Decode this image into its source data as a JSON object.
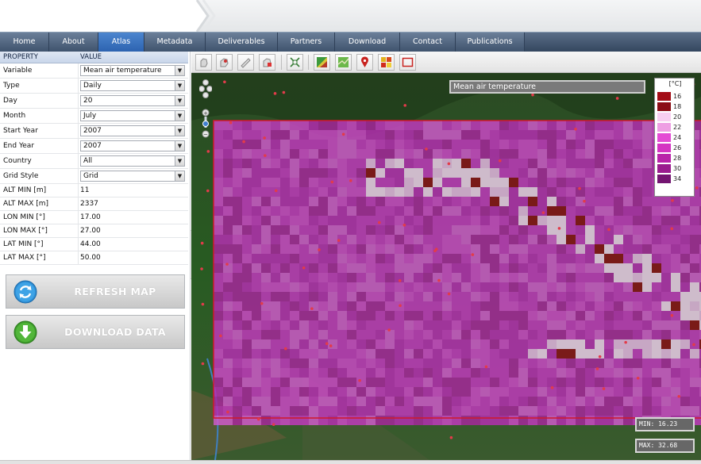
{
  "nav": {
    "items": [
      {
        "label": "Home",
        "active": false
      },
      {
        "label": "About",
        "active": false
      },
      {
        "label": "Atlas",
        "active": true
      },
      {
        "label": "Metadata",
        "active": false
      },
      {
        "label": "Deliverables",
        "active": false
      },
      {
        "label": "Partners",
        "active": false
      },
      {
        "label": "Download",
        "active": false
      },
      {
        "label": "Contact",
        "active": false
      },
      {
        "label": "Publications",
        "active": false
      }
    ]
  },
  "properties": {
    "header_property": "PROPERTY",
    "header_value": "VALUE",
    "rows": [
      {
        "label": "Variable",
        "value": "Mean air temperature",
        "dropdown": true
      },
      {
        "label": "Type",
        "value": "Daily",
        "dropdown": true
      },
      {
        "label": "Day",
        "value": "20",
        "dropdown": true
      },
      {
        "label": "Month",
        "value": "July",
        "dropdown": true
      },
      {
        "label": "Start Year",
        "value": "2007",
        "dropdown": true
      },
      {
        "label": "End Year",
        "value": "2007",
        "dropdown": true
      },
      {
        "label": "Country",
        "value": "All",
        "dropdown": true
      },
      {
        "label": "Grid Style",
        "value": "Grid",
        "dropdown": true
      },
      {
        "label": "ALT MIN [m]",
        "value": "11",
        "dropdown": false
      },
      {
        "label": "ALT MAX [m]",
        "value": "2337",
        "dropdown": false
      },
      {
        "label": "LON MIN [°]",
        "value": "17.00",
        "dropdown": false
      },
      {
        "label": "LON MAX [°]",
        "value": "27.00",
        "dropdown": false
      },
      {
        "label": "LAT MIN [°]",
        "value": "44.00",
        "dropdown": false
      },
      {
        "label": "LAT MAX [°]",
        "value": "50.00",
        "dropdown": false
      }
    ]
  },
  "buttons": {
    "refresh": "REFRESH MAP",
    "download": "DOWNLOAD DATA"
  },
  "toolbar": {
    "tools": [
      "pan-icon",
      "zoom-box-icon",
      "measure-icon",
      "info-icon",
      "full-extent-icon",
      "layer-color-icon",
      "map-layer-icon",
      "station-marker-icon",
      "grid-layer-icon",
      "bounding-box-icon"
    ]
  },
  "map": {
    "layer_title": "Mean air temperature",
    "legend_unit": "[°C]",
    "legend": [
      {
        "label": "16",
        "color": "#a30c16"
      },
      {
        "label": "18",
        "color": "#8b0d16"
      },
      {
        "label": "20",
        "color": "#f7cff0"
      },
      {
        "label": "22",
        "color": "#ee9fe3"
      },
      {
        "label": "24",
        "color": "#e44bd4"
      },
      {
        "label": "26",
        "color": "#d533c2"
      },
      {
        "label": "28",
        "color": "#b923a9"
      },
      {
        "label": "30",
        "color": "#9a1c8e"
      },
      {
        "label": "34",
        "color": "#741571"
      }
    ],
    "min_label": "MIN: 16.23",
    "max_label": "MAX: 32.68"
  },
  "colors": {
    "nav_active": "#2d63b0",
    "grid_overlay": "#c236bf",
    "grid_border": "#d0182a"
  }
}
